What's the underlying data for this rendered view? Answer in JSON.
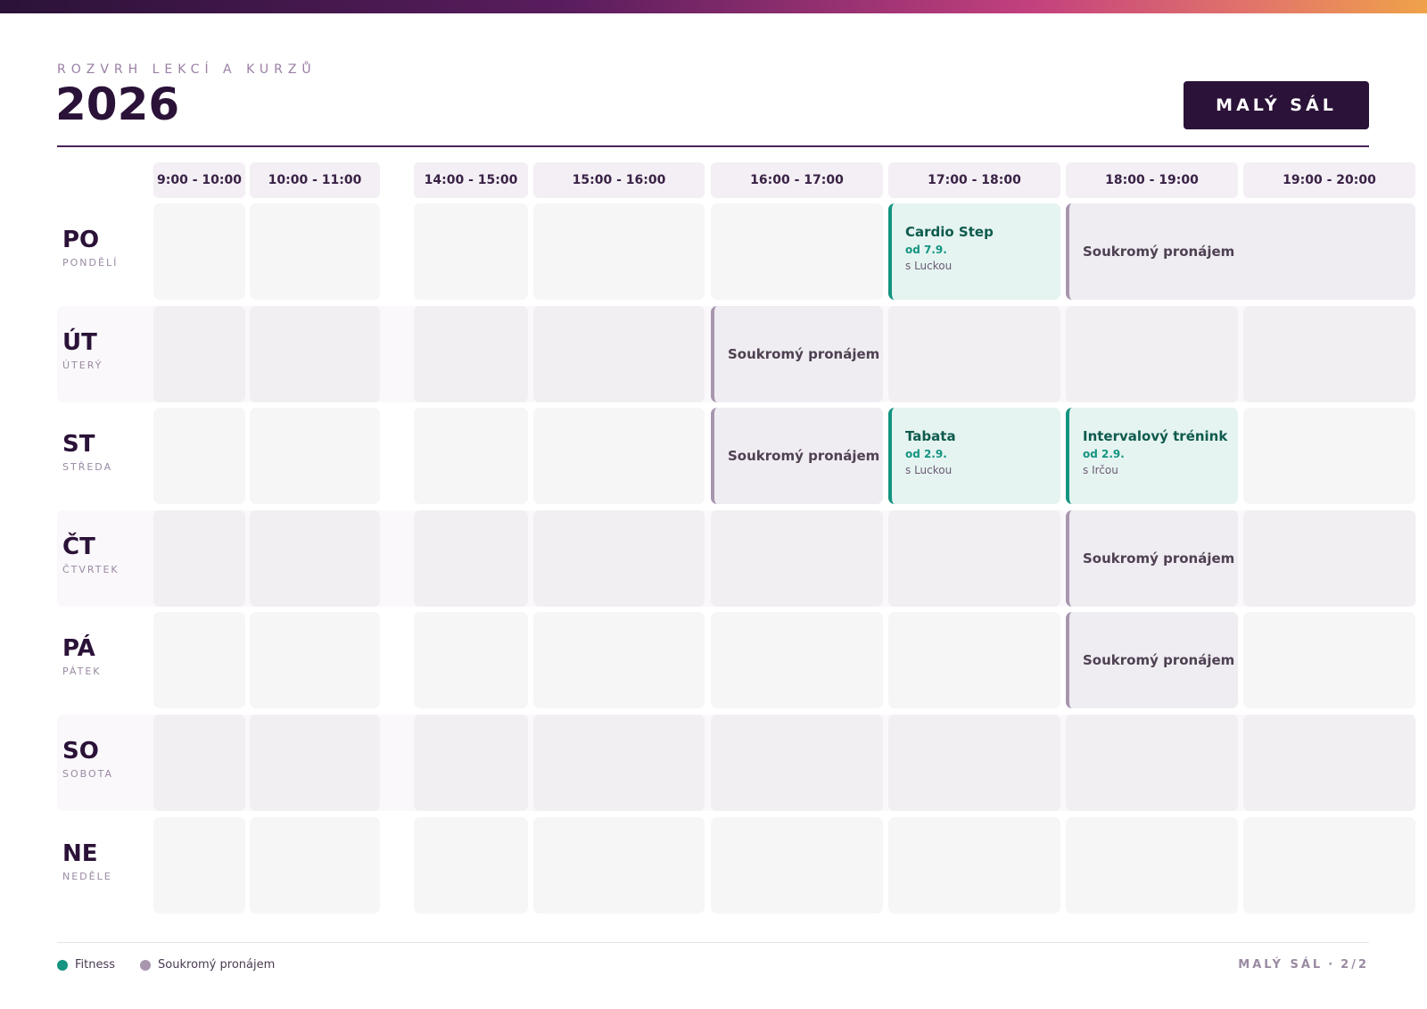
{
  "header": {
    "subtitle": "ROZVRH LEKCÍ A KURZŮ",
    "year": "2026",
    "room": "MALÝ SÁL"
  },
  "slots": [
    "9:00 - 10:00",
    "10:00 - 11:00",
    "14:00 - 15:00",
    "15:00 - 16:00",
    "16:00 - 17:00",
    "17:00 - 18:00",
    "18:00 - 19:00",
    "19:00 - 20:00"
  ],
  "days": [
    {
      "abbr": "PO",
      "name": "PONDĚLÍ"
    },
    {
      "abbr": "ÚT",
      "name": "ÚTERÝ"
    },
    {
      "abbr": "ST",
      "name": "STŘEDA"
    },
    {
      "abbr": "ČT",
      "name": "ČTVRTEK"
    },
    {
      "abbr": "PÁ",
      "name": "PÁTEK"
    },
    {
      "abbr": "SO",
      "name": "SOBOTA"
    },
    {
      "abbr": "NE",
      "name": "NEDĚLE"
    }
  ],
  "events": [
    {
      "day": 0,
      "slot": 5,
      "span": 1,
      "kind": "fitness",
      "title": "Cardio Step",
      "date": "od 7.9.",
      "with": "s Luckou"
    },
    {
      "day": 0,
      "slot": 6,
      "span": 2,
      "kind": "private",
      "title": "Soukromý pronájem"
    },
    {
      "day": 1,
      "slot": 4,
      "span": 1,
      "kind": "private",
      "title": "Soukromý pronájem"
    },
    {
      "day": 2,
      "slot": 4,
      "span": 1,
      "kind": "private",
      "title": "Soukromý pronájem"
    },
    {
      "day": 2,
      "slot": 5,
      "span": 1,
      "kind": "fitness",
      "title": "Tabata",
      "date": "od 2.9.",
      "with": "s Luckou"
    },
    {
      "day": 2,
      "slot": 6,
      "span": 1,
      "kind": "fitness",
      "title": "Intervalový trénink",
      "date": "od 2.9.",
      "with": "s Irčou"
    },
    {
      "day": 3,
      "slot": 6,
      "span": 1,
      "kind": "private",
      "title": "Soukromý pronájem"
    },
    {
      "day": 4,
      "slot": 6,
      "span": 1,
      "kind": "private",
      "title": "Soukromý pronájem"
    }
  ],
  "legend": [
    {
      "label": "Fitness",
      "color": "#149481"
    },
    {
      "label": "Soukromý pronájem",
      "color": "#a896af"
    }
  ],
  "footer": {
    "room": "MALÝ SÁL",
    "separator": "·",
    "page": "2/2"
  },
  "colors": {
    "primary": "#2b1238",
    "fitness": "#149481",
    "private": "#a896af"
  }
}
